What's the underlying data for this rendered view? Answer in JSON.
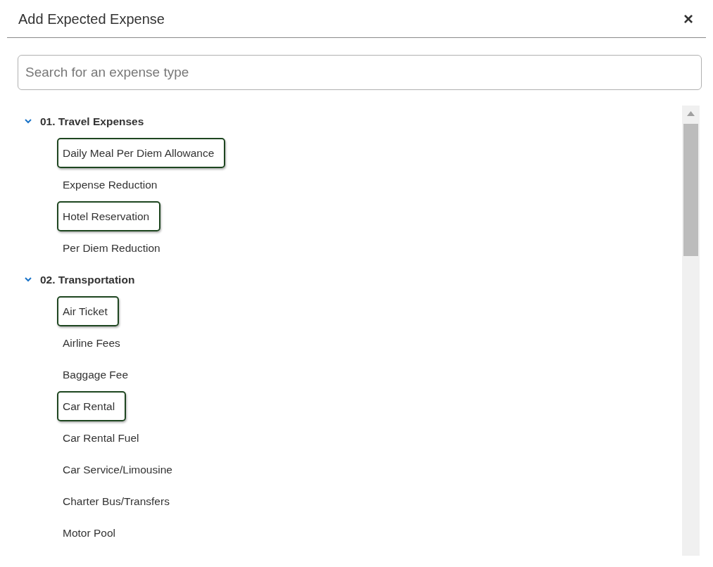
{
  "dialog": {
    "title": "Add Expected Expense",
    "close": "×"
  },
  "search": {
    "placeholder": "Search for an expense type"
  },
  "groups": [
    {
      "label": "01. Travel Expenses",
      "expanded": true,
      "children": [
        {
          "label": "Daily Meal Per Diem Allowance",
          "highlighted": true
        },
        {
          "label": "Expense Reduction",
          "highlighted": false
        },
        {
          "label": "Hotel Reservation",
          "highlighted": true
        },
        {
          "label": "Per Diem Reduction",
          "highlighted": false
        }
      ]
    },
    {
      "label": "02. Transportation",
      "expanded": true,
      "children": [
        {
          "label": "Air Ticket",
          "highlighted": true
        },
        {
          "label": "Airline Fees",
          "highlighted": false
        },
        {
          "label": "Baggage Fee",
          "highlighted": false
        },
        {
          "label": "Car Rental",
          "highlighted": true
        },
        {
          "label": "Car Rental Fuel",
          "highlighted": false
        },
        {
          "label": "Car Service/Limousine",
          "highlighted": false
        },
        {
          "label": "Charter Bus/Transfers",
          "highlighted": false
        },
        {
          "label": "Motor Pool",
          "highlighted": false
        }
      ]
    }
  ]
}
